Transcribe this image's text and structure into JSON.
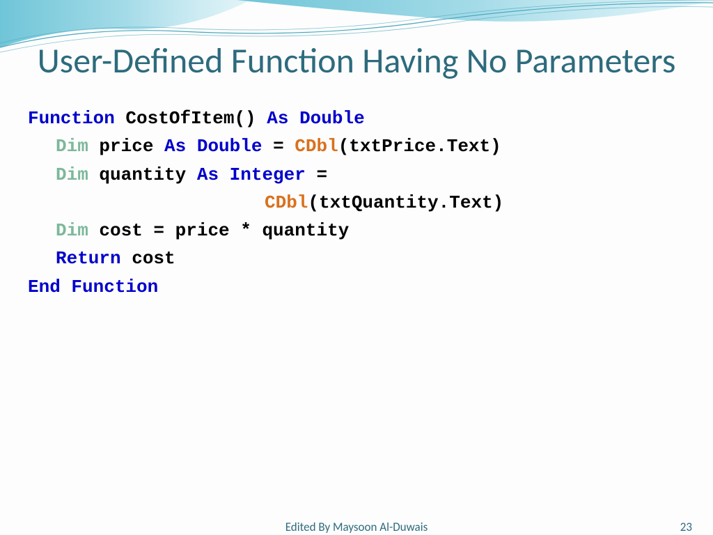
{
  "title": "User-Defined Function Having No Parameters",
  "code": {
    "l1a": "Function",
    "l1b": " CostOfItem() ",
    "l1c": "As Double",
    "l2a": "Dim",
    "l2b": " price ",
    "l2c": "As Double",
    "l2d": " = ",
    "l2e": "CDbl",
    "l2f": "(txtPrice.Text)",
    "l3a": "Dim",
    "l3b": " quantity ",
    "l3c": "As Integer",
    "l3d": " =",
    "l4a": "CDbl",
    "l4b": "(txtQuantity.Text)",
    "l5a": "Dim",
    "l5b": " cost = price * quantity",
    "l6a": "Return",
    "l6b": " cost",
    "l7a": "End Function"
  },
  "footer": {
    "editor": "Edited By Maysoon Al-Duwais",
    "page": "23"
  }
}
